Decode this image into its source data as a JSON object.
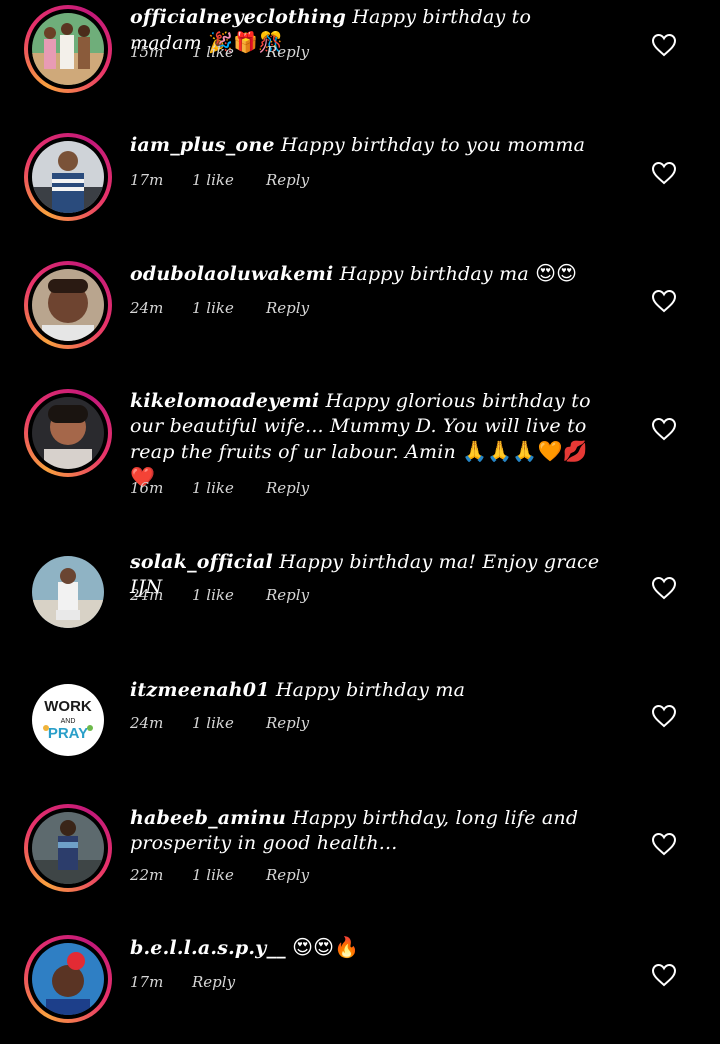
{
  "comments": [
    {
      "username": "officialneyeclothing",
      "text": " Happy birthday to madam ",
      "emoji": "🎉🎁🎊",
      "time": "15m",
      "likes": "1 like",
      "reply": "Reply"
    },
    {
      "username": "iam_plus_one",
      "text": " Happy birthday to you momma",
      "emoji": "",
      "time": "17m",
      "likes": "1 like",
      "reply": "Reply"
    },
    {
      "username": "odubolaoluwakemi",
      "text": " Happy birthday ma ",
      "emoji": "😍😍",
      "time": "24m",
      "likes": "1 like",
      "reply": "Reply"
    },
    {
      "username": "kikelomoadeyemi",
      "text": " Happy glorious birthday to our beautiful wife... Mummy D. You will live to reap the fruits of ur labour. Amin ",
      "emoji": "🙏🙏🙏🧡💋❤️",
      "time": "16m",
      "likes": "1 like",
      "reply": "Reply"
    },
    {
      "username": "solak_official",
      "text": " Happy birthday ma! Enjoy grace IJN",
      "emoji": "",
      "time": "24m",
      "likes": "1 like",
      "reply": "Reply"
    },
    {
      "username": "itzmeenah01",
      "text": " Happy birthday ma",
      "emoji": "",
      "time": "24m",
      "likes": "1 like",
      "reply": "Reply",
      "avatar_text_top": "WORK",
      "avatar_text_mid": "AND",
      "avatar_text_bottom": "PRAY"
    },
    {
      "username": "habeeb_aminu",
      "text": " Happy birthday, long life and prosperity in good health...",
      "emoji": "",
      "time": "22m",
      "likes": "1 like",
      "reply": "Reply"
    },
    {
      "username": "b.e.l.l.a.s.p.y__",
      "text": " ",
      "emoji": "😍😍🔥",
      "time": "17m",
      "likes": "",
      "reply": "Reply"
    }
  ],
  "colors": {
    "background": "#000000",
    "text": "#ffffff",
    "meta": "#d6d6d6",
    "story_ring_start": "#f9a03f",
    "story_ring_end": "#c2187a"
  },
  "icons": {
    "like": "heart-outline-icon"
  }
}
